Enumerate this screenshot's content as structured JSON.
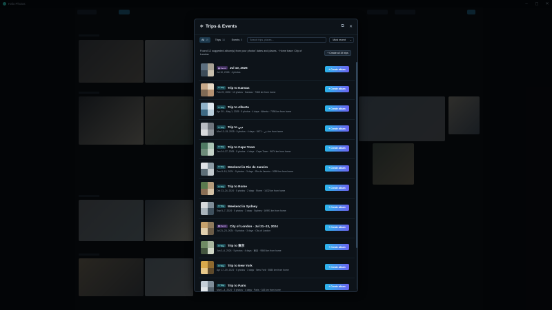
{
  "app": {
    "title": "Halo Photos"
  },
  "window_controls": {
    "minimize": "–",
    "maximize": "◻",
    "close": "✕"
  },
  "modal": {
    "title": "Trips & Events",
    "title_icon": "✈",
    "header_icons": [
      "expand-icon",
      "close-icon"
    ],
    "tabs": [
      {
        "label": "All",
        "count": "19",
        "active": true
      },
      {
        "label": "Trips",
        "count": "14",
        "active": false
      },
      {
        "label": "Events",
        "count": "5",
        "active": false
      }
    ],
    "search_placeholder": "Search trips, places...",
    "sort_value": "Most recent",
    "summary": "Found 12 suggested album(s) from your photos' dates and places. · Home base: City of London",
    "create_all_label": "+ Create all 19 trips",
    "create_album_label": "+ Create album",
    "items": [
      {
        "badge": "Event",
        "badge_type": "event",
        "title": "Jul 10, 2026",
        "subtitle": "Jul 10, 2026 · 4 photos",
        "thumb": [
          "#5b6e7e",
          "#a8a294",
          "#3d4c58",
          "#c9c0ae"
        ]
      },
      {
        "badge": "Trip",
        "badge_type": "trip",
        "title": "Trip to Kansas",
        "subtitle": "Feb 20, 2026 · 13 photos · Kansas · 7365 km from home",
        "thumb": [
          "#c7a98a",
          "#e7d8c4",
          "#7f6a55",
          "#b59272"
        ]
      },
      {
        "badge": "Trip",
        "badge_type": "trip",
        "title": "Trip to Alberta",
        "subtitle": "Apr 30 – May 1, 2025 · 5 photos · 4 days · Alberta · 7098 km from home",
        "thumb": [
          "#8fb2c8",
          "#dfe8ef",
          "#3e6b85",
          "#b9cfdc"
        ]
      },
      {
        "badge": "Trip",
        "badge_type": "trip",
        "title": "Trip to دبي",
        "subtitle": "Mar 12–15, 2025 · 5 photos · 4 days · دبي · 5471 km from home",
        "thumb": [
          "#b8bcc2",
          "#6e747c",
          "#d8dadd",
          "#8c9299"
        ]
      },
      {
        "badge": "Trip",
        "badge_type": "trip",
        "title": "Trip to Cape Town",
        "subtitle": "Jan 24–27, 2025 · 5 photos · 4 days · Cape Town · 9674 km from home",
        "thumb": [
          "#4f7a63",
          "#a9c3b3",
          "#6d8c7a",
          "#c4d3c8"
        ]
      },
      {
        "badge": "Trip",
        "badge_type": "trip",
        "title": "Weekend in Rio de Janeiro",
        "subtitle": "Dec 8–10, 2024 · 5 photos · 3 days · Rio de Janeiro · 9289 km from home",
        "thumb": [
          "#dfe3e6",
          "#8b9aa3",
          "#5e6f78",
          "#c2c9cd"
        ]
      },
      {
        "badge": "Trip",
        "badge_type": "trip",
        "title": "Trip to Rome",
        "subtitle": "Oct 23–24, 2024 · 5 photos · 2 days · Rome · 1432 km from home",
        "thumb": [
          "#5a7a4e",
          "#b49b7a",
          "#8a6f55",
          "#d4c2a6"
        ]
      },
      {
        "badge": "Trip",
        "badge_type": "trip",
        "title": "Weekend in Sydney",
        "subtitle": "Sep 5–7, 2024 · 5 photos · 3 days · Sydney · 16991 km from home",
        "thumb": [
          "#d6d9dc",
          "#7e8c97",
          "#a9b4bc",
          "#3f505d"
        ]
      },
      {
        "badge": "Event",
        "badge_type": "event",
        "title": "City of London · Jul 21–23, 2024",
        "subtitle": "Jul 21–23, 2024 · 5 photos · 3 days · City of London",
        "thumb": [
          "#c6a26d",
          "#8f7a5c",
          "#e0cfae",
          "#6b5c48"
        ]
      },
      {
        "badge": "Trip",
        "badge_type": "trip",
        "title": "Trip to 東京",
        "subtitle": "Jun 3–6, 2024 · 5 photos · 4 days · 東京 · 9560 km from home",
        "thumb": [
          "#6f8a64",
          "#a7b59d",
          "#43553f",
          "#cfd6c6"
        ]
      },
      {
        "badge": "Trip",
        "badge_type": "trip",
        "title": "Trip to New York",
        "subtitle": "Apr 17–19, 2024 · 5 photos · 3 days · New York · 5580 km from home",
        "thumb": [
          "#d9a94b",
          "#8f6a2f",
          "#e8c98a",
          "#5e4a2c"
        ]
      },
      {
        "badge": "Trip",
        "badge_type": "trip",
        "title": "Trip to Paris",
        "subtitle": "Mar 1–4, 2024 · 5 photos · 4 days · Paris · 343 km from home",
        "thumb": [
          "#c5cfd8",
          "#7f8d99",
          "#e3e8ec",
          "#56636e"
        ]
      }
    ]
  },
  "background": {
    "tile_colors": [
      "#3a3f45",
      "#6a6f73",
      "#2b3138",
      "#5c5a55",
      "#4a5866",
      "#7c7a72",
      "#3d4a45",
      "#565b60",
      "#3e4a57",
      "#6b6455",
      "#5d6b73",
      "#8a8a80"
    ]
  }
}
